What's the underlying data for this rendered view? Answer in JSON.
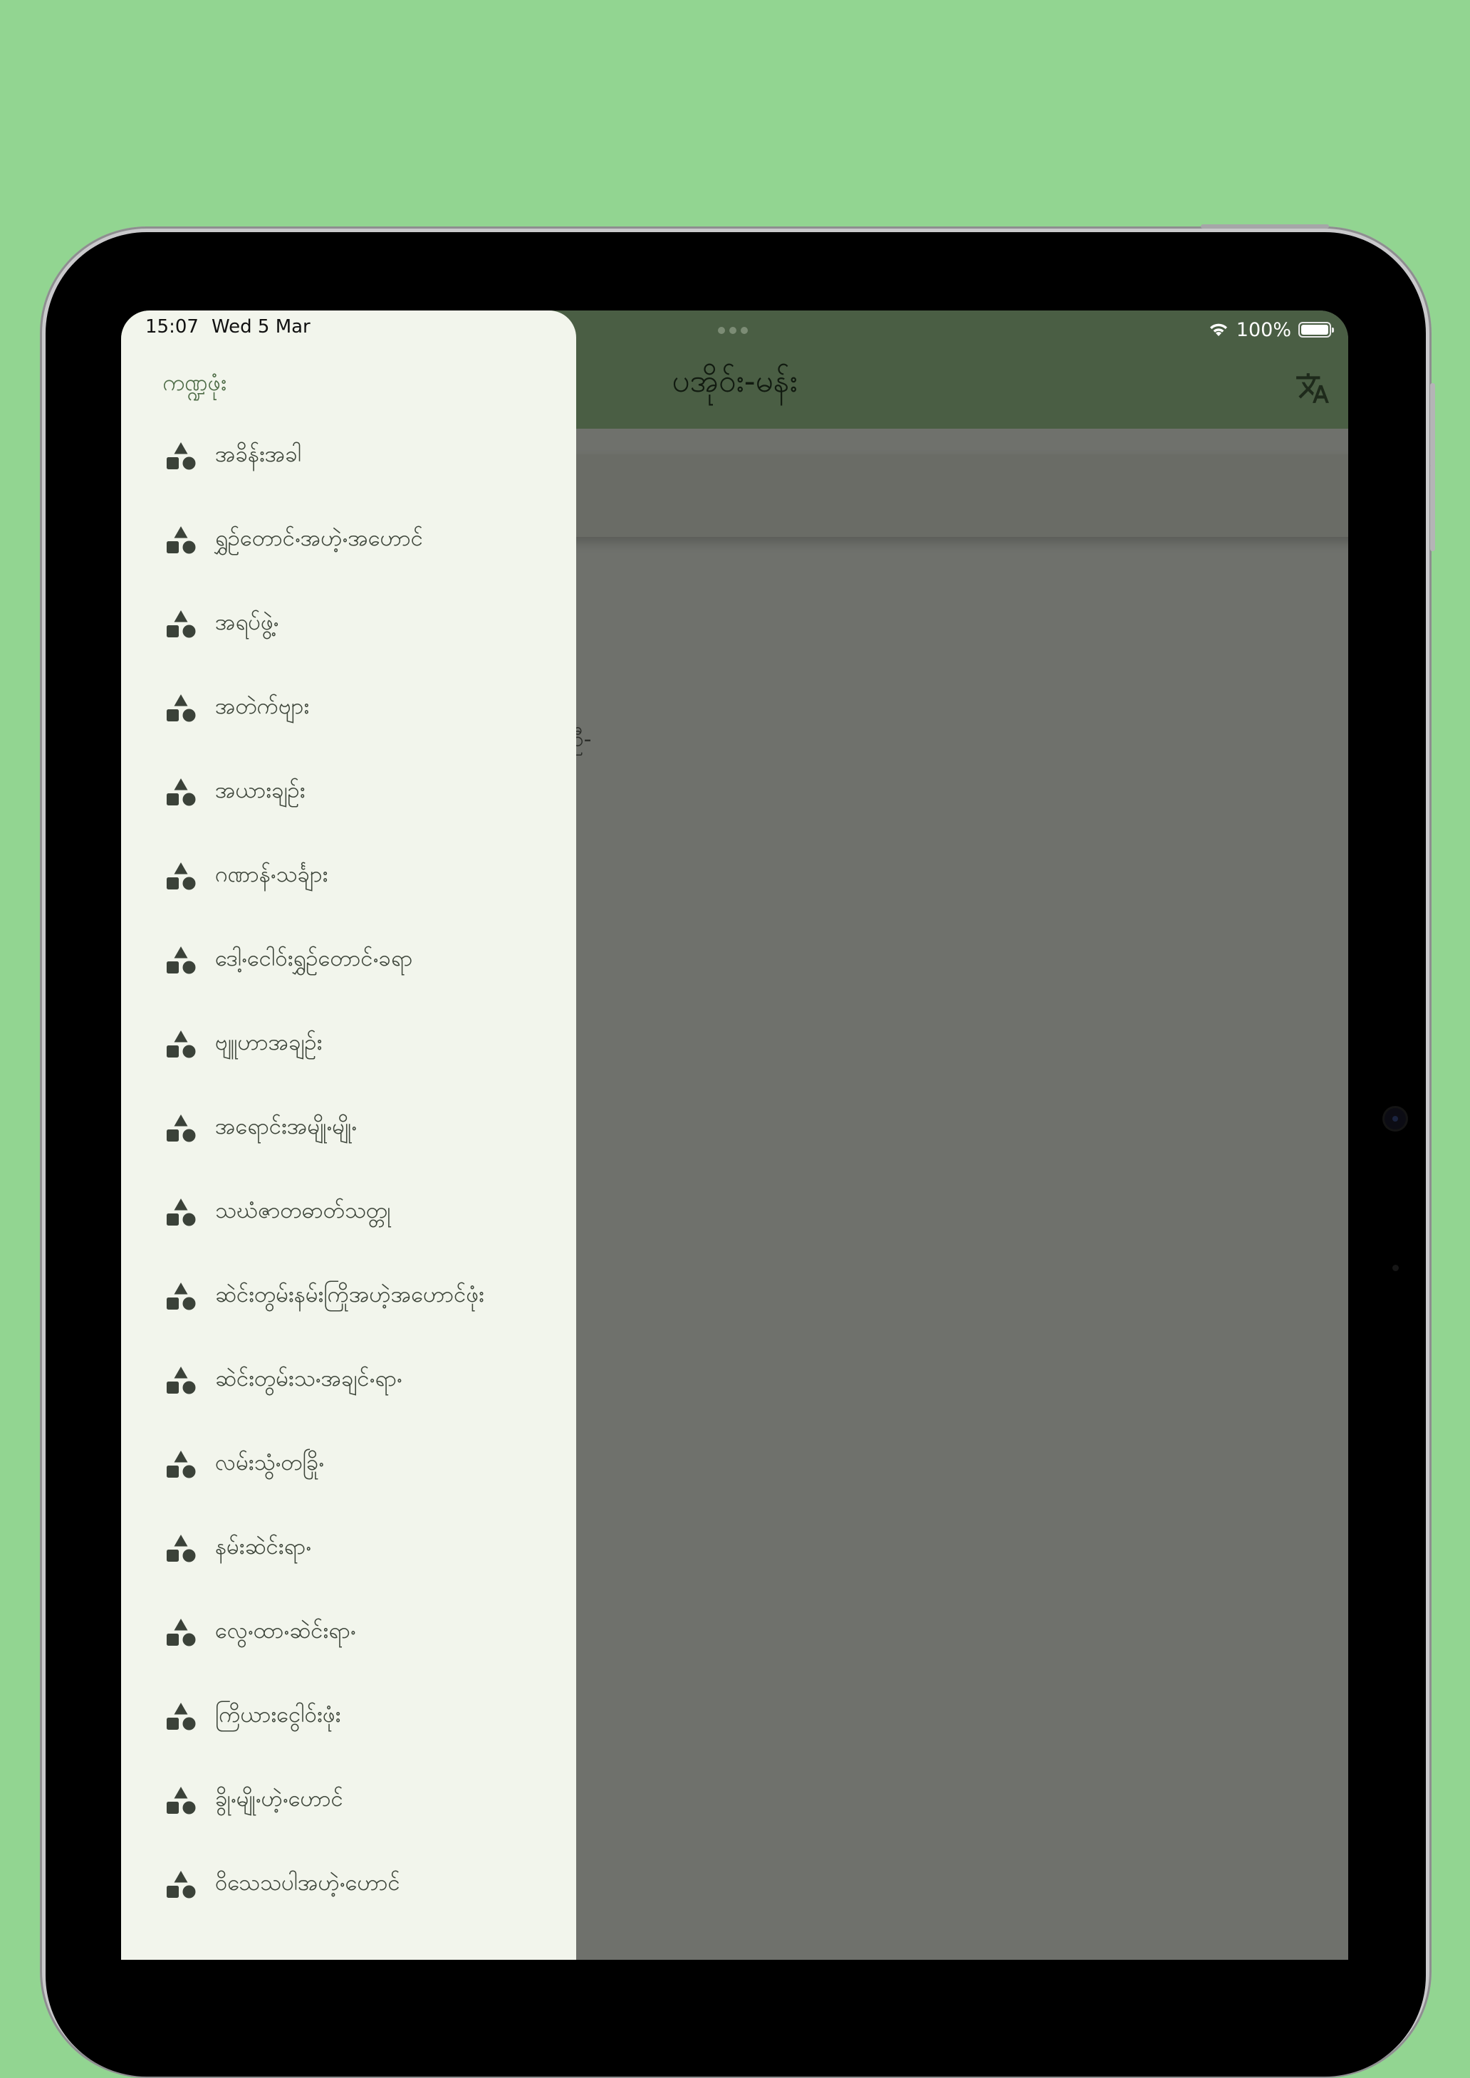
{
  "status_bar": {
    "time": "15:07",
    "date": "Wed 5 Mar",
    "battery": "100%"
  },
  "app_bar": {
    "title": "ပအိုဝ်း-မန်း",
    "translate_icon": "translate-icon"
  },
  "background": {
    "fragment_text": "ဦ-"
  },
  "drawer": {
    "header": "ကဏ္ဍဖုံး",
    "item_icon": "category-icon",
    "items": [
      {
        "label": "အခိန်းအခါ"
      },
      {
        "label": "ရွှဥ်တောင်ႋအဟဲ့ႋအဟောင်"
      },
      {
        "label": "အရပ်ဖွဲ့ႋ"
      },
      {
        "label": "အတဲက်ဗျား"
      },
      {
        "label": "အယားချဉ်း"
      },
      {
        "label": "ဂဏာန်ႋသင်္ချား"
      },
      {
        "label": "ဒေါ့ႋငေါဝ်းရွှဥ်တောင်ႋခရာ"
      },
      {
        "label": "ဗျူဟာအချဉ်း"
      },
      {
        "label": "အရောင်းအမျိုႋမျိုႋ"
      },
      {
        "label": "သဃံဇာတဓာတ်သတ္တု"
      },
      {
        "label": "ဆဲင်းတွမ်းနမ်းကြိုအဟဲ့အဟောင်ဖုံး"
      },
      {
        "label": "ဆဲင်းတွမ်းသႋအချင်ႋရာႋ"
      },
      {
        "label": "လမ်းသွံႋတခြိုႋ"
      },
      {
        "label": "နမ်းဆဲင်းရာႋ"
      },
      {
        "label": "လွေႋထာႋဆဲင်းရာႋ"
      },
      {
        "label": "ကြိယားငွေါဝ်းဖုံး"
      },
      {
        "label": "ခွိုႋမျိုႋဟဲ့ႋဟောင်"
      },
      {
        "label": "ဝိသေသပါအဟဲ့ႋဟောင်"
      }
    ]
  }
}
